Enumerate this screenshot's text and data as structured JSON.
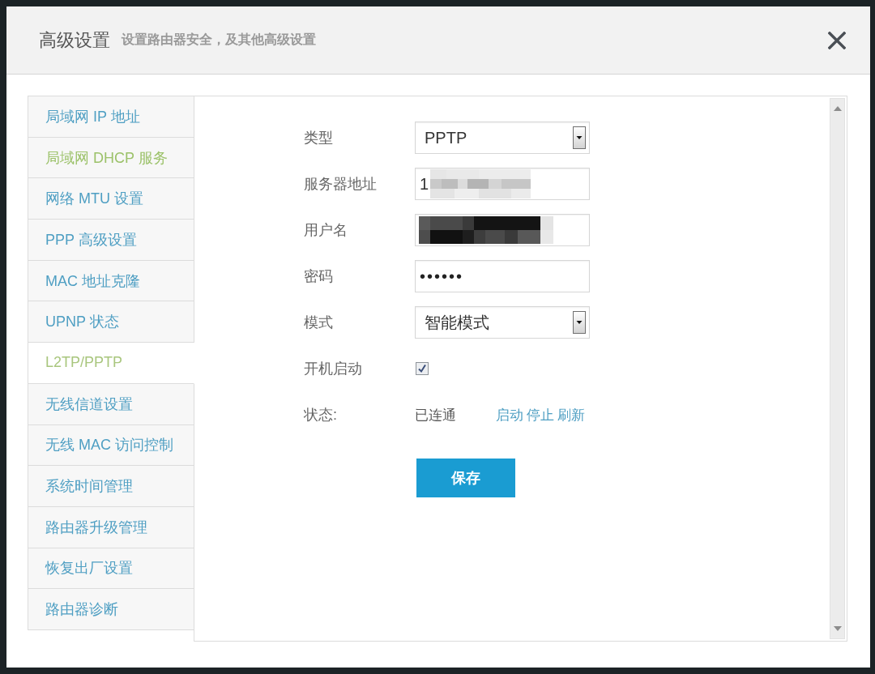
{
  "dialog": {
    "title": "高级设置",
    "subtitle": "设置路由器安全，及其他高级设置"
  },
  "sidebar": {
    "items": [
      {
        "label": "局域网 IP 地址",
        "selected": false,
        "hovered": false
      },
      {
        "label": "局域网 DHCP 服务",
        "selected": false,
        "hovered": true
      },
      {
        "label": "网络 MTU 设置",
        "selected": false,
        "hovered": false
      },
      {
        "label": "PPP 高级设置",
        "selected": false,
        "hovered": false
      },
      {
        "label": "MAC 地址克隆",
        "selected": false,
        "hovered": false
      },
      {
        "label": "UPNP 状态",
        "selected": false,
        "hovered": false
      },
      {
        "label": "L2TP/PPTP",
        "selected": true,
        "hovered": false
      },
      {
        "label": "无线信道设置",
        "selected": false,
        "hovered": false
      },
      {
        "label": "无线 MAC 访问控制",
        "selected": false,
        "hovered": false
      },
      {
        "label": "系统时间管理",
        "selected": false,
        "hovered": false
      },
      {
        "label": "路由器升级管理",
        "selected": false,
        "hovered": false
      },
      {
        "label": "恢复出厂设置",
        "selected": false,
        "hovered": false
      },
      {
        "label": "路由器诊断",
        "selected": false,
        "hovered": false
      }
    ]
  },
  "form": {
    "fields": [
      {
        "kind": "select",
        "label": "类型",
        "value": "PPTP"
      },
      {
        "kind": "text",
        "label": "服务器地址",
        "value": "1",
        "redaction": {
          "kind": "light"
        }
      },
      {
        "kind": "text",
        "label": "用户名",
        "redaction": {
          "kind": "dark"
        }
      },
      {
        "kind": "password",
        "label": "密码",
        "value": "••••••"
      },
      {
        "kind": "select",
        "label": "模式",
        "value": "智能模式"
      },
      {
        "kind": "checkbox",
        "label": "开机启动",
        "checked": true
      },
      {
        "kind": "status",
        "label": "状态:",
        "value": "已连通",
        "links": [
          "启动",
          "停止",
          "刷新"
        ]
      }
    ],
    "save_button": "保存"
  }
}
